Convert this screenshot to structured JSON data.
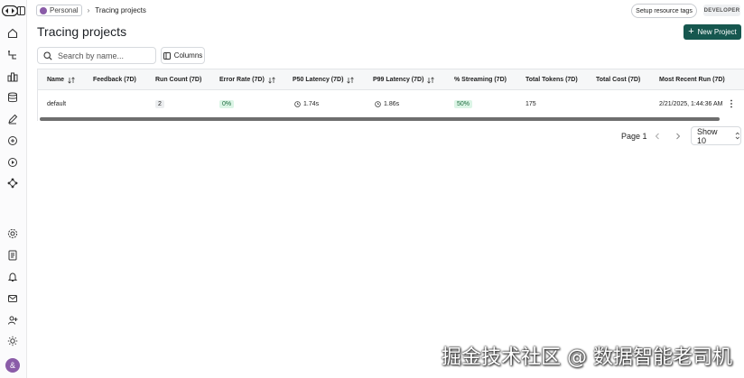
{
  "breadcrumb": {
    "workspace": "Personal",
    "separator": "›",
    "current": "Tracing projects"
  },
  "header": {
    "setup_tags_label": "Setup resource tags",
    "badge": "DEVELOPER"
  },
  "page": {
    "title": "Tracing projects",
    "new_project_label": "New Project"
  },
  "toolbar": {
    "search_placeholder": "Search by name...",
    "columns_label": "Columns"
  },
  "table": {
    "columns": [
      "Name",
      "Feedback (7D)",
      "Run Count (7D)",
      "Error Rate (7D)",
      "P50 Latency (7D)",
      "P99 Latency (7D)",
      "% Streaming (7D)",
      "Total Tokens (7D)",
      "Total Cost (7D)",
      "Most Recent Run (7D)"
    ],
    "rows": [
      {
        "name": "default",
        "feedback": "",
        "run_count": "2",
        "error_rate": "0%",
        "p50_latency": "1.74s",
        "p99_latency": "1.86s",
        "streaming": "50%",
        "total_tokens": "175",
        "total_cost": "",
        "most_recent_run": "2/21/2025, 1:44:36 AM"
      }
    ]
  },
  "pagination": {
    "page_label": "Page 1",
    "show_label": "Show 10"
  },
  "avatar_initial": "&",
  "watermark": "掘金技术社区 @ 数据智能老司机",
  "colors": {
    "accent": "#16574f",
    "success_bg": "#dcf5e6",
    "success_text": "#1c6b3e"
  },
  "rail_icons": [
    "home-icon",
    "tracing-icon",
    "monitor-icon",
    "datasets-icon",
    "annotate-icon",
    "chat-icon",
    "playground-icon",
    "deployments-icon",
    "settings-icon",
    "docs-icon",
    "notifications-icon",
    "inbox-icon",
    "add-user-icon",
    "theme-icon"
  ]
}
